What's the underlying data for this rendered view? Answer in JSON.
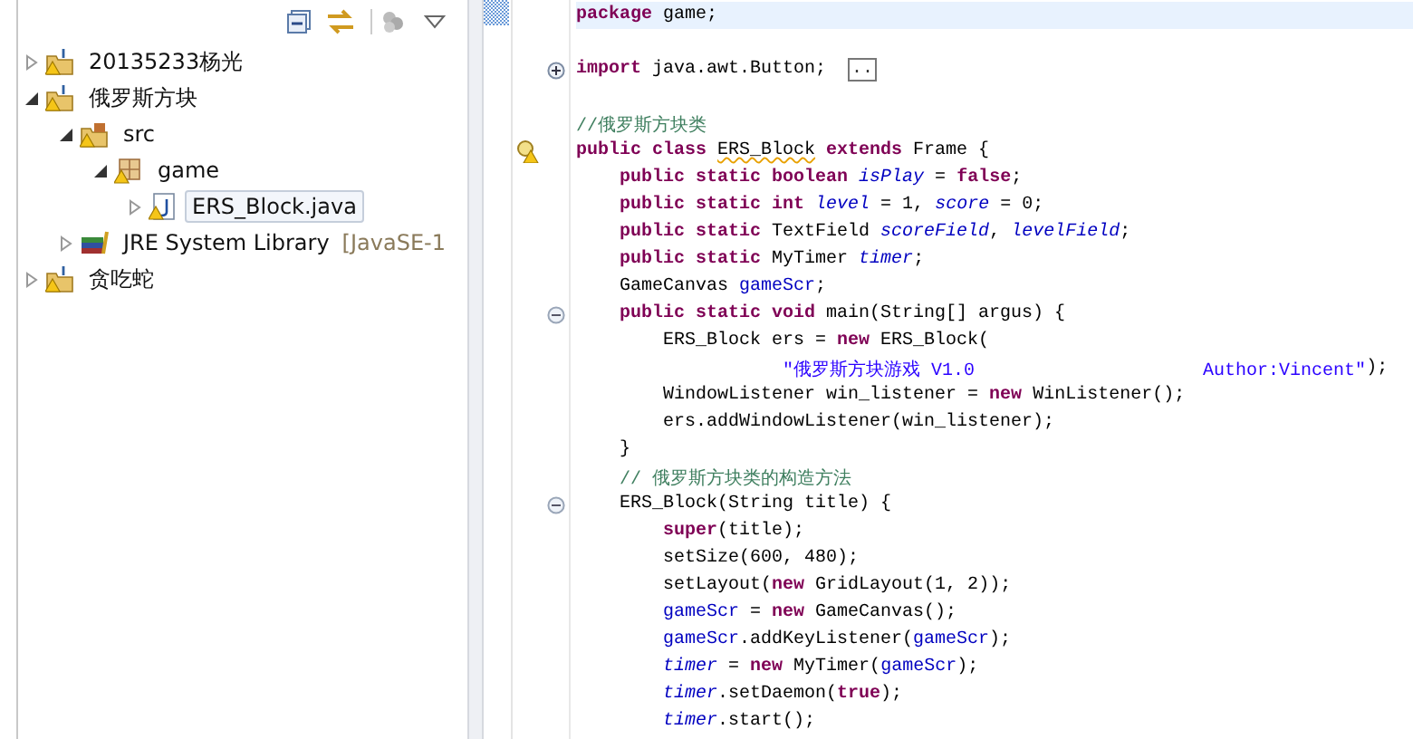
{
  "explorer": {
    "items": [
      {
        "label": "20135233杨光",
        "kind": "project",
        "warning": true,
        "expanded": false,
        "selected": false
      },
      {
        "label": "俄罗斯方块",
        "kind": "project",
        "warning": true,
        "expanded": true,
        "selected": false,
        "children": [
          {
            "label": "src",
            "kind": "source-folder",
            "warning": true,
            "expanded": true,
            "selected": false,
            "children": [
              {
                "label": "game",
                "kind": "package",
                "warning": true,
                "expanded": true,
                "selected": false,
                "children": [
                  {
                    "label": "ERS_Block.java",
                    "kind": "java-file",
                    "warning": true,
                    "expanded": false,
                    "selected": true
                  }
                ]
              }
            ]
          },
          {
            "label": "JRE System Library",
            "suffix": "[JavaSE-1",
            "kind": "library",
            "warning": false,
            "expanded": false,
            "selected": false
          }
        ]
      },
      {
        "label": "贪吃蛇",
        "kind": "project",
        "warning": true,
        "expanded": false,
        "selected": false
      }
    ]
  },
  "editor": {
    "lines": [
      {
        "kind": "plain",
        "current": true,
        "tokens": [
          {
            "kind": "keyword",
            "text": "package"
          },
          {
            "kind": "plain",
            "text": " game;"
          }
        ]
      },
      {
        "kind": "plain",
        "current": false
      },
      {
        "kind": "fold-collapsed",
        "current": false,
        "tokens": [
          {
            "kind": "keyword",
            "text": "import"
          },
          {
            "kind": "plain",
            "text": " java.awt.Button;  "
          },
          {
            "kind": "folded",
            "text": ".."
          }
        ]
      },
      {
        "kind": "plain",
        "current": false
      },
      {
        "kind": "plain",
        "current": false,
        "tokens": [
          {
            "kind": "comment",
            "text": "//俄罗斯方块类"
          }
        ]
      },
      {
        "kind": "warning",
        "current": false,
        "tokens": [
          {
            "kind": "keyword",
            "text": "public class "
          },
          {
            "kind": "warn-type",
            "text": "ERS_Block"
          },
          {
            "kind": "keyword",
            "text": " extends"
          },
          {
            "kind": "plain",
            "text": " Frame {"
          }
        ]
      },
      {
        "kind": "plain",
        "current": false,
        "tokens": [
          {
            "kind": "keyword",
            "text": "    public static boolean "
          },
          {
            "kind": "static",
            "text": "isPlay"
          },
          {
            "kind": "plain",
            "text": " = "
          },
          {
            "kind": "keyword",
            "text": "false"
          },
          {
            "kind": "plain",
            "text": ";"
          }
        ]
      },
      {
        "kind": "plain",
        "current": false,
        "tokens": [
          {
            "kind": "keyword",
            "text": "    public static int "
          },
          {
            "kind": "static",
            "text": "level"
          },
          {
            "kind": "plain",
            "text": " = 1, "
          },
          {
            "kind": "static",
            "text": "score"
          },
          {
            "kind": "plain",
            "text": " = 0;"
          }
        ]
      },
      {
        "kind": "plain",
        "current": false,
        "tokens": [
          {
            "kind": "keyword",
            "text": "    public static "
          },
          {
            "kind": "plain",
            "text": "TextField "
          },
          {
            "kind": "static",
            "text": "scoreField"
          },
          {
            "kind": "plain",
            "text": ", "
          },
          {
            "kind": "static",
            "text": "levelField"
          },
          {
            "kind": "plain",
            "text": ";"
          }
        ]
      },
      {
        "kind": "plain",
        "current": false,
        "tokens": [
          {
            "kind": "keyword",
            "text": "    public static "
          },
          {
            "kind": "plain",
            "text": "MyTimer "
          },
          {
            "kind": "static",
            "text": "timer"
          },
          {
            "kind": "plain",
            "text": ";"
          }
        ]
      },
      {
        "kind": "plain",
        "current": false,
        "tokens": [
          {
            "kind": "plain",
            "text": "    GameCanvas "
          },
          {
            "kind": "field",
            "text": "gameScr"
          },
          {
            "kind": "plain",
            "text": ";"
          }
        ]
      },
      {
        "kind": "fold-expanded",
        "current": false,
        "tokens": [
          {
            "kind": "keyword",
            "text": "    public static void "
          },
          {
            "kind": "plain",
            "text": "main(String[] argus) {"
          }
        ]
      },
      {
        "kind": "plain",
        "current": false,
        "tokens": [
          {
            "kind": "plain",
            "text": "        ERS_Block ers = "
          },
          {
            "kind": "keyword",
            "text": "new"
          },
          {
            "kind": "plain",
            "text": " ERS_Block("
          }
        ]
      },
      {
        "kind": "plain",
        "current": false,
        "tokens": [
          {
            "kind": "string",
            "text": "                   \"俄罗斯方块游戏 V1.0                     Author:Vincent\""
          },
          {
            "kind": "plain",
            "text": ");"
          }
        ]
      },
      {
        "kind": "plain",
        "current": false,
        "tokens": [
          {
            "kind": "plain",
            "text": "        WindowListener win_listener = "
          },
          {
            "kind": "keyword",
            "text": "new"
          },
          {
            "kind": "plain",
            "text": " WinListener();"
          }
        ]
      },
      {
        "kind": "plain",
        "current": false,
        "tokens": [
          {
            "kind": "plain",
            "text": "        ers.addWindowListener(win_listener);"
          }
        ]
      },
      {
        "kind": "plain",
        "current": false,
        "tokens": [
          {
            "kind": "plain",
            "text": "    }"
          }
        ]
      },
      {
        "kind": "plain",
        "current": false,
        "tokens": [
          {
            "kind": "comment",
            "text": "    // 俄罗斯方块类的构造方法"
          }
        ]
      },
      {
        "kind": "fold-expanded",
        "current": false,
        "tokens": [
          {
            "kind": "plain",
            "text": "    ERS_Block(String title) {"
          }
        ]
      },
      {
        "kind": "plain",
        "current": false,
        "tokens": [
          {
            "kind": "keyword",
            "text": "        super"
          },
          {
            "kind": "plain",
            "text": "(title);"
          }
        ]
      },
      {
        "kind": "plain",
        "current": false,
        "tokens": [
          {
            "kind": "plain",
            "text": "        setSize(600, 480);"
          }
        ]
      },
      {
        "kind": "plain",
        "current": false,
        "tokens": [
          {
            "kind": "plain",
            "text": "        setLayout("
          },
          {
            "kind": "keyword",
            "text": "new"
          },
          {
            "kind": "plain",
            "text": " GridLayout(1, 2));"
          }
        ]
      },
      {
        "kind": "plain",
        "current": false,
        "tokens": [
          {
            "kind": "field",
            "text": "        gameScr"
          },
          {
            "kind": "plain",
            "text": " = "
          },
          {
            "kind": "keyword",
            "text": "new"
          },
          {
            "kind": "plain",
            "text": " GameCanvas();"
          }
        ]
      },
      {
        "kind": "plain",
        "current": false,
        "tokens": [
          {
            "kind": "field",
            "text": "        gameScr"
          },
          {
            "kind": "plain",
            "text": ".addKeyListener("
          },
          {
            "kind": "field",
            "text": "gameScr"
          },
          {
            "kind": "plain",
            "text": ");"
          }
        ]
      },
      {
        "kind": "plain",
        "current": false,
        "tokens": [
          {
            "kind": "static",
            "text": "        timer"
          },
          {
            "kind": "plain",
            "text": " = "
          },
          {
            "kind": "keyword",
            "text": "new"
          },
          {
            "kind": "plain",
            "text": " MyTimer("
          },
          {
            "kind": "field",
            "text": "gameScr"
          },
          {
            "kind": "plain",
            "text": ");"
          }
        ]
      },
      {
        "kind": "plain",
        "current": false,
        "tokens": [
          {
            "kind": "static",
            "text": "        timer"
          },
          {
            "kind": "plain",
            "text": ".setDaemon("
          },
          {
            "kind": "keyword",
            "text": "true"
          },
          {
            "kind": "plain",
            "text": ");"
          }
        ]
      },
      {
        "kind": "plain",
        "current": false,
        "tokens": [
          {
            "kind": "static",
            "text": "        timer"
          },
          {
            "kind": "plain",
            "text": ".start();"
          }
        ]
      }
    ]
  }
}
